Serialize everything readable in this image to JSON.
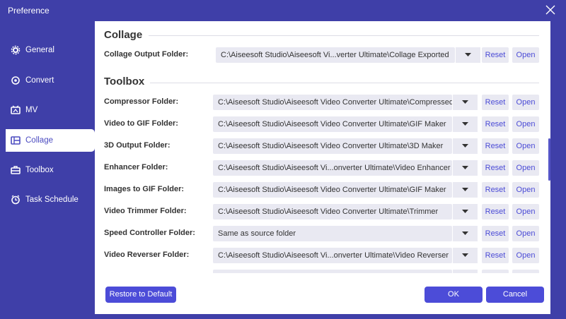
{
  "window": {
    "title": "Preference"
  },
  "sidebar": {
    "items": [
      {
        "label": "General"
      },
      {
        "label": "Convert"
      },
      {
        "label": "MV"
      },
      {
        "label": "Collage"
      },
      {
        "label": "Toolbox"
      },
      {
        "label": "Task Schedule"
      }
    ],
    "active_index": 3
  },
  "collage": {
    "title": "Collage",
    "rows": [
      {
        "label": "Collage Output Folder:",
        "path": "C:\\Aiseesoft Studio\\Aiseesoft Vi...verter Ultimate\\Collage Exported"
      }
    ]
  },
  "toolbox": {
    "title": "Toolbox",
    "rows": [
      {
        "label": "Compressor Folder:",
        "path": "C:\\Aiseesoft Studio\\Aiseesoft Video Converter Ultimate\\Compressed"
      },
      {
        "label": "Video to GIF Folder:",
        "path": "C:\\Aiseesoft Studio\\Aiseesoft Video Converter Ultimate\\GIF Maker"
      },
      {
        "label": "3D Output Folder:",
        "path": "C:\\Aiseesoft Studio\\Aiseesoft Video Converter Ultimate\\3D Maker"
      },
      {
        "label": "Enhancer Folder:",
        "path": "C:\\Aiseesoft Studio\\Aiseesoft Vi...onverter Ultimate\\Video Enhancer"
      },
      {
        "label": "Images to GIF Folder:",
        "path": "C:\\Aiseesoft Studio\\Aiseesoft Video Converter Ultimate\\GIF Maker"
      },
      {
        "label": "Video Trimmer Folder:",
        "path": "C:\\Aiseesoft Studio\\Aiseesoft Video Converter Ultimate\\Trimmer"
      },
      {
        "label": "Speed Controller Folder:",
        "path": "Same as source folder"
      },
      {
        "label": "Video Reverser Folder:",
        "path": "C:\\Aiseesoft Studio\\Aiseesoft Vi...onverter Ultimate\\Video Reverser"
      }
    ]
  },
  "row_buttons": {
    "reset": "Reset",
    "open": "Open"
  },
  "footer": {
    "restore": "Restore to Default",
    "ok": "OK",
    "cancel": "Cancel"
  }
}
